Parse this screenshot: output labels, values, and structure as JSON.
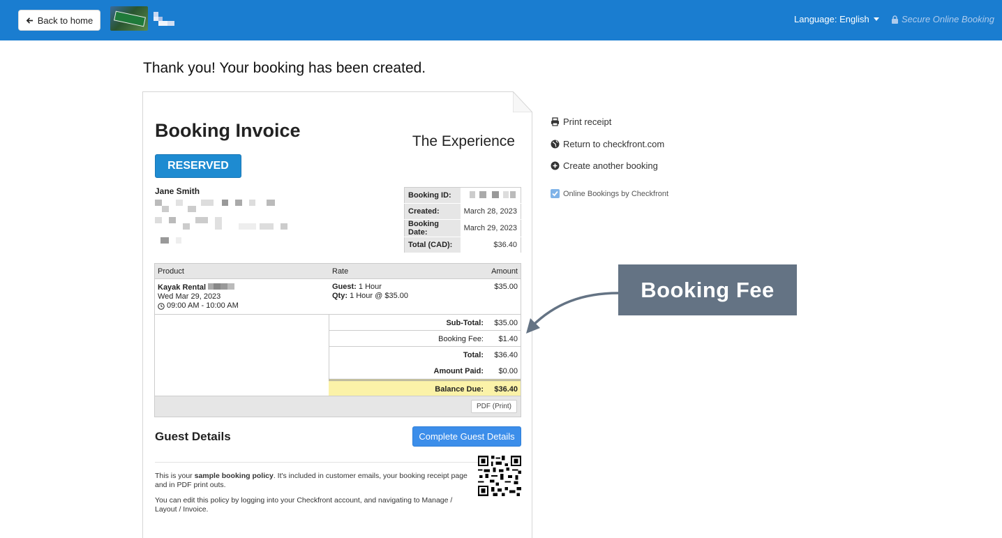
{
  "topbar": {
    "back_label": "Back to home",
    "language_label": "Language: English",
    "secure_label": "Secure Online Booking"
  },
  "page": {
    "heading": "Thank you! Your booking has been created."
  },
  "invoice": {
    "title": "Booking Invoice",
    "company": "The Experience",
    "status": "RESERVED",
    "customer_name": "Jane Smith",
    "meta": [
      {
        "label": "Booking ID:",
        "value": ""
      },
      {
        "label": "Created:",
        "value": "March 28, 2023"
      },
      {
        "label": "Booking Date:",
        "value": "March 29, 2023"
      },
      {
        "label": "Total (CAD):",
        "value": "$36.40"
      }
    ],
    "columns": {
      "product": "Product",
      "rate": "Rate",
      "amount": "Amount"
    },
    "item": {
      "name": "Kayak Rental",
      "date": "Wed Mar 29, 2023",
      "time": "09:00 AM - 10:00 AM",
      "guest_label": "Guest:",
      "guest_value": "1 Hour",
      "qty_label": "Qty:",
      "qty_value": "1 Hour @ $35.00",
      "amount": "$35.00"
    },
    "totals": {
      "subtotal_label": "Sub-Total:",
      "subtotal": "$35.00",
      "fee_label": "Booking Fee:",
      "fee": "$1.40",
      "total_label": "Total:",
      "total": "$36.40",
      "paid_label": "Amount Paid:",
      "paid": "$0.00",
      "balance_label": "Balance Due:",
      "balance": "$36.40"
    },
    "pdf_label": "PDF (Print)",
    "guest_details_title": "Guest Details",
    "guest_details_button": "Complete Guest Details",
    "policy": {
      "p1_pre": "This is your ",
      "p1_bold": "sample booking policy",
      "p1_post": ". It's included in customer emails, your booking receipt page and in PDF print outs.",
      "p2": "You can edit this policy by logging into your Checkfront account, and navigating to Manage / Layout / Invoice."
    }
  },
  "side_links": {
    "print": "Print receipt",
    "return": "Return to checkfront.com",
    "create": "Create another booking",
    "powered": "Online Bookings by Checkfront"
  },
  "callout": {
    "text": "Booking Fee"
  },
  "colors": {
    "topbar": "#1a7dd0",
    "status": "#1e8bd1",
    "balance_highlight": "#fbf2a8",
    "callout": "#647384"
  }
}
